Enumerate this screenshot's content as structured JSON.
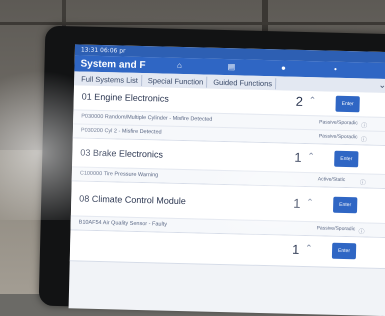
{
  "status_bar": {
    "text": "13:31 06:06 pr"
  },
  "app_bar": {
    "title": "System and F",
    "icons": [
      "home-icon",
      "document-icon",
      "person-icon",
      "settings-icon"
    ]
  },
  "tabs": [
    {
      "label": "Full Systems List"
    },
    {
      "label": "Special Function"
    },
    {
      "label": "Guided Functions"
    }
  ],
  "modules": [
    {
      "title": "01 Engine Electronics",
      "count": "2",
      "enter_label": "Enter",
      "faults": [
        {
          "code": "P030000 Random/Multiple Cylinder - Misfire Detected",
          "status": "Passive/Sporadic"
        },
        {
          "code": "P030200 Cyl 2 - Misfire Detected",
          "status": "Passive/Sporadic"
        }
      ]
    },
    {
      "title": "03 Brake Electronics",
      "count": "1",
      "enter_label": "Enter",
      "faults": [
        {
          "code": "C100000 Tire Pressure Warning",
          "status": "Active/Static"
        }
      ]
    },
    {
      "title": "08 Climate Control Module",
      "count": "1",
      "enter_label": "Enter",
      "faults": [
        {
          "code": "B10AF54 Air Quality Sensor - Faulty",
          "status": "Passive/Sporadic"
        }
      ]
    },
    {
      "title": "",
      "count": "1",
      "enter_label": "Enter",
      "faults": []
    }
  ],
  "colors": {
    "accent": "#2f66c4",
    "app_bar": "#2f66c4",
    "screen_bg": "#f1f3f7"
  }
}
